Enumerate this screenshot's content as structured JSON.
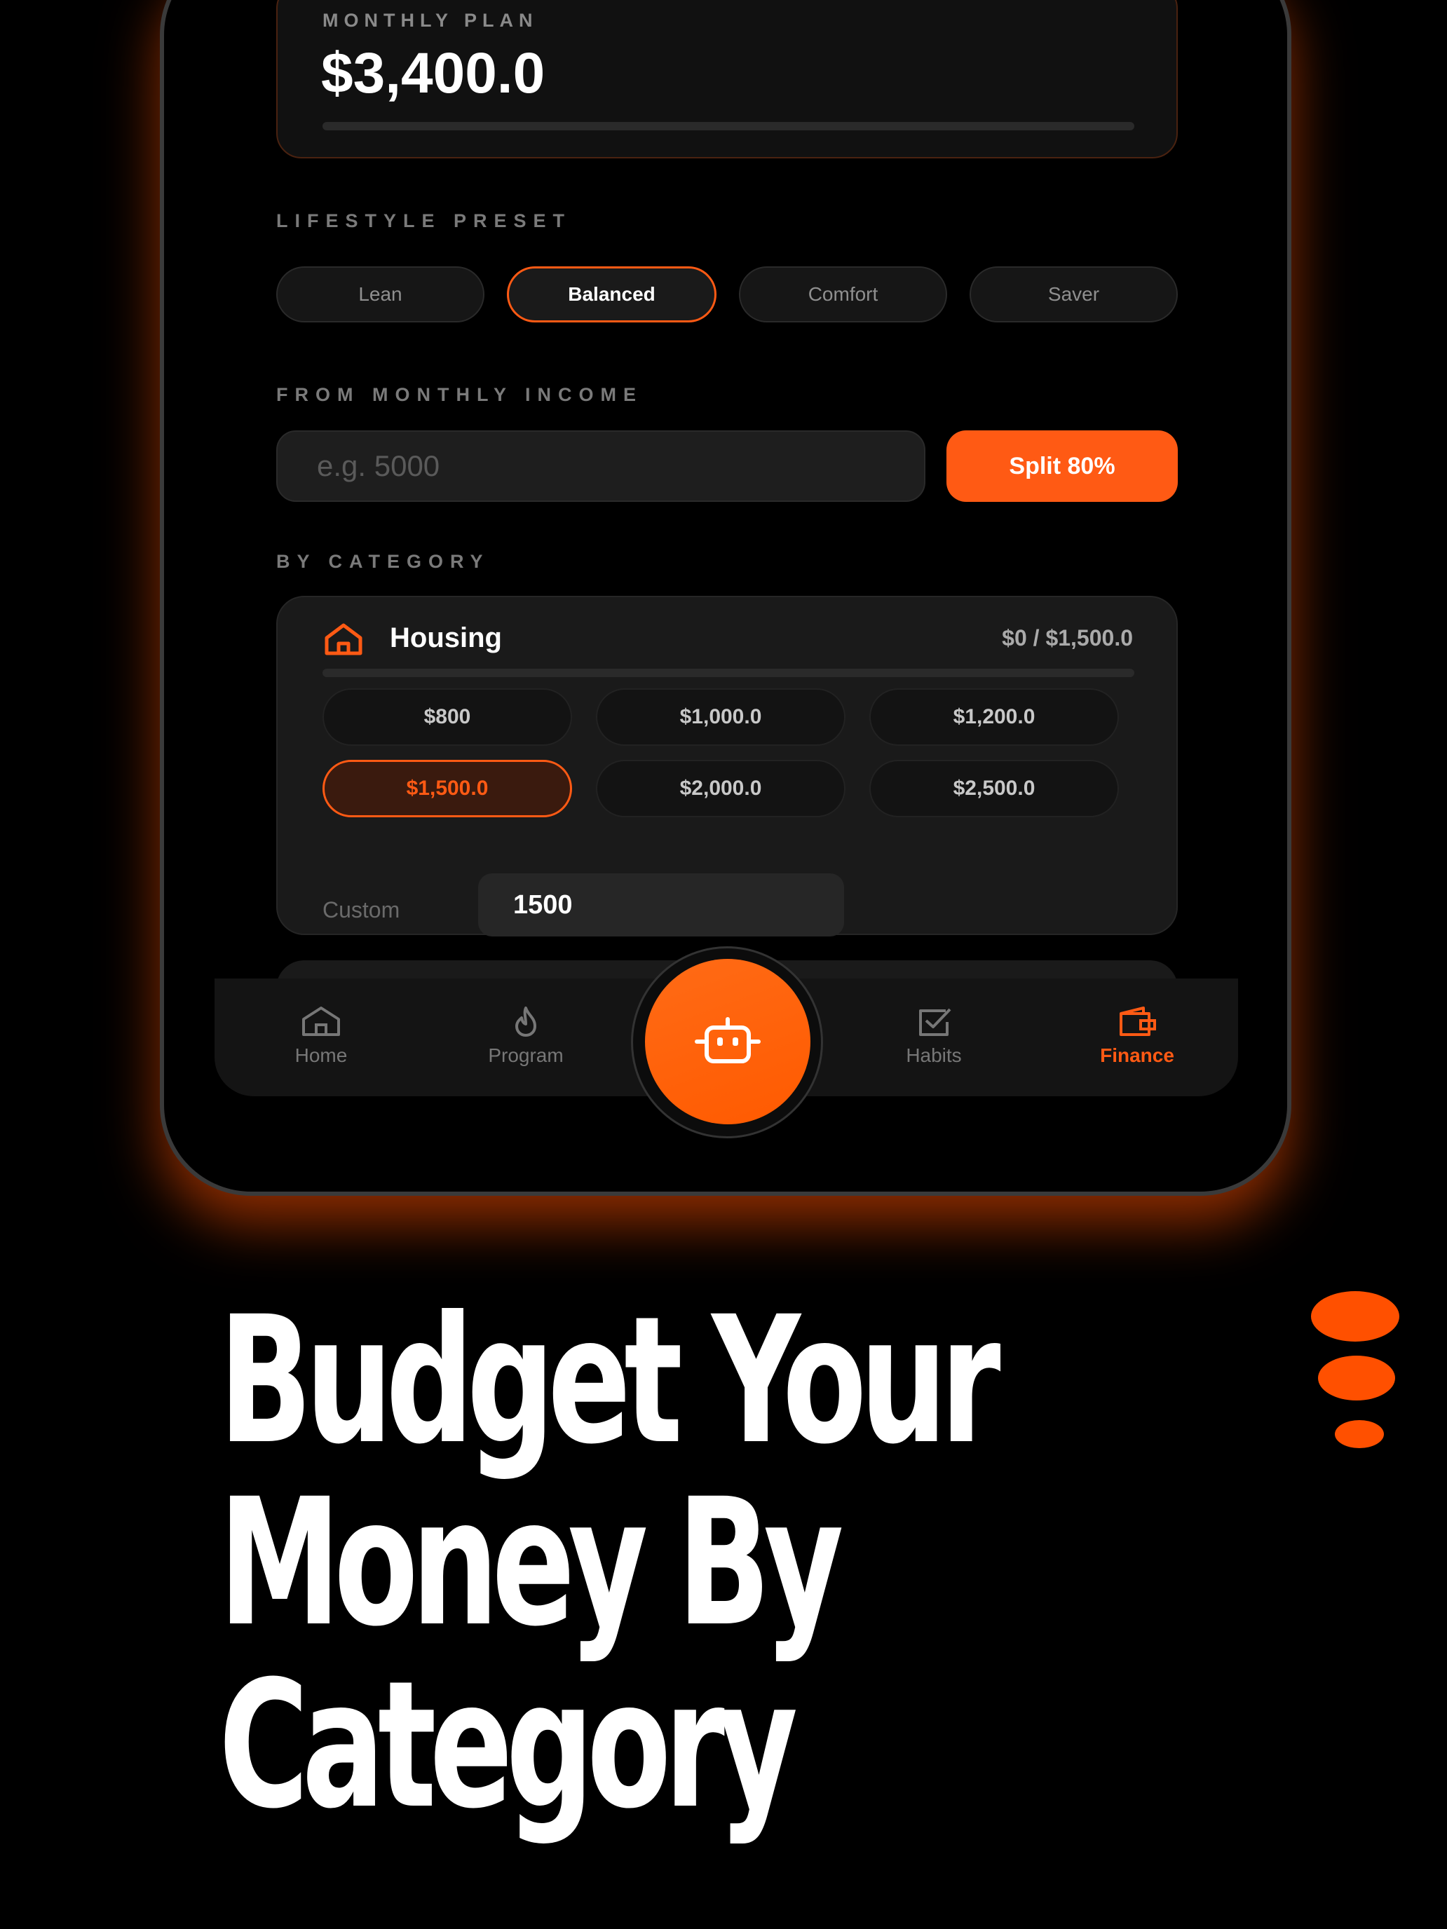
{
  "plan": {
    "label": "MONTHLY PLAN",
    "amount": "$3,400.0"
  },
  "preset": {
    "label": "LIFESTYLE PRESET",
    "options": [
      "Lean",
      "Balanced",
      "Comfort",
      "Saver"
    ],
    "selected": "Balanced"
  },
  "income": {
    "label": "FROM MONTHLY INCOME",
    "placeholder": "e.g. 5000",
    "split_button": "Split 80%"
  },
  "category_section": {
    "label": "BY CATEGORY"
  },
  "housing": {
    "name": "Housing",
    "icon": "home-icon",
    "total": "$0 / $1,500.0",
    "amounts": [
      "$800",
      "$1,000.0",
      "$1,200.0",
      "$1,500.0",
      "$2,000.0",
      "$2,500.0"
    ],
    "selected": "$1,500.0",
    "custom_label": "Custom",
    "custom_value": "1500"
  },
  "tabs": [
    {
      "label": "Home",
      "icon": "home-icon"
    },
    {
      "label": "Program",
      "icon": "flame-icon"
    },
    {
      "label": "Habits",
      "icon": "checkbox-icon"
    },
    {
      "label": "Finance",
      "icon": "wallet-icon"
    }
  ],
  "active_tab": "Finance",
  "fab_icon": "robot-icon",
  "headline": [
    "Budget Your",
    "Money By",
    "Category"
  ],
  "colors": {
    "accent": "#ff5a14",
    "background": "#000000",
    "card": "#1a1a1a"
  }
}
